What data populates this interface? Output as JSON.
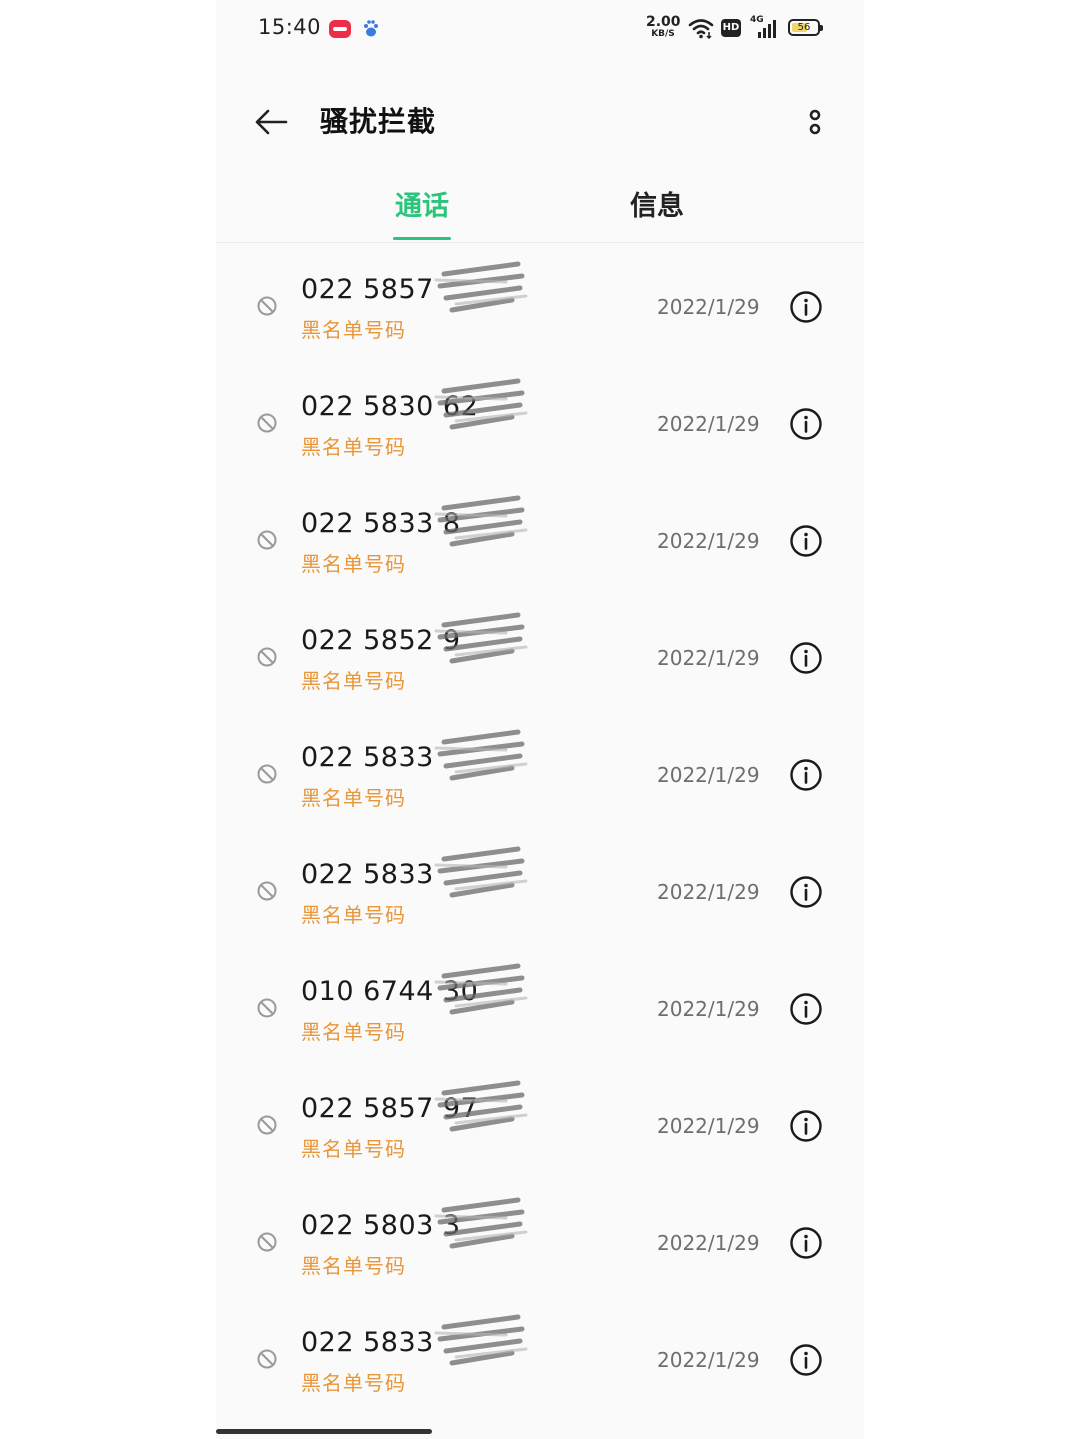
{
  "status_bar": {
    "time": "15:40",
    "net_speed_value": "2.00",
    "net_speed_unit": "KB/S",
    "hd_label": "HD",
    "network_type": "4G",
    "battery_level": "56"
  },
  "header": {
    "title": "骚扰拦截"
  },
  "tabs": {
    "calls": "通话",
    "messages": "信息",
    "active": "calls",
    "accent_color": "#2cc37a"
  },
  "calls": [
    {
      "number": "022 5857",
      "tag": "黑名单号码",
      "date": "2022/1/29"
    },
    {
      "number": "022 5830 62",
      "tag": "黑名单号码",
      "date": "2022/1/29"
    },
    {
      "number": "022 5833 8",
      "tag": "黑名单号码",
      "date": "2022/1/29"
    },
    {
      "number": "022 5852 9",
      "tag": "黑名单号码",
      "date": "2022/1/29"
    },
    {
      "number": "022 5833",
      "tag": "黑名单号码",
      "date": "2022/1/29"
    },
    {
      "number": "022 5833",
      "tag": "黑名单号码",
      "date": "2022/1/29"
    },
    {
      "number": "010 6744 30",
      "tag": "黑名单号码",
      "date": "2022/1/29"
    },
    {
      "number": "022 5857 97",
      "tag": "黑名单号码",
      "date": "2022/1/29"
    },
    {
      "number": "022 5803 3",
      "tag": "黑名单号码",
      "date": "2022/1/29"
    },
    {
      "number": "022 5833",
      "tag": "黑名单号码",
      "date": "2022/1/29"
    }
  ],
  "tag_color": "#e8963a"
}
